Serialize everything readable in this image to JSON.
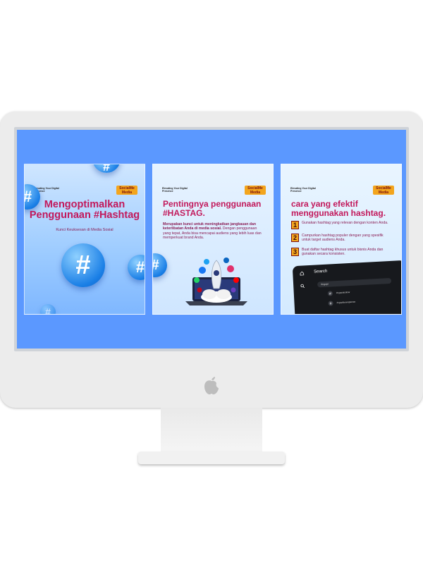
{
  "card1": {
    "brand": "Elevating Your Digital Presence",
    "badge": "SocialMe Media",
    "title": "Mengoptimalkan Penggunaan #Hashtag",
    "subtitle": "Kunci Keuksesan di Media Sosial",
    "hashtag_symbol": "#"
  },
  "card2": {
    "brand": "Elevating Your Digital Presence",
    "badge": "SocialMe Media",
    "title": "Pentingnya penggunaan #HASTAG.",
    "body_bold": "Merupakan kunci untuk meningkatkan jangkauan dan keterlibatan Anda di media sosial.",
    "body": " Dengan penggunaan yang tepat, Anda bisa mencapai audiens yang lebih luas dan memperkuat brand Anda."
  },
  "card3": {
    "brand": "Elevating Your Digital Presence",
    "badge": "SocialMe Media",
    "title": "cara yang efektif menggunakan hashtag.",
    "steps": [
      {
        "num": "1",
        "text": "Gunakan hashtag yang relevan dengan konten Anda."
      },
      {
        "num": "2",
        "text": "Campurkan hashtag populer dengan yang spesifik untuk target audiens Anda."
      },
      {
        "num": "3",
        "text": "Buat daftar hashtag khusus untuk bisnis Anda dan gunakan secara konsisten."
      }
    ],
    "phone": {
      "search_label": "Search",
      "search_value": "#ngopi",
      "results": [
        "#ngopidulubiar",
        "#ngopibarengteman"
      ]
    }
  },
  "colors": {
    "screen": "#5b98ff",
    "title": "#c2185b",
    "accent": "#f3a51d"
  }
}
